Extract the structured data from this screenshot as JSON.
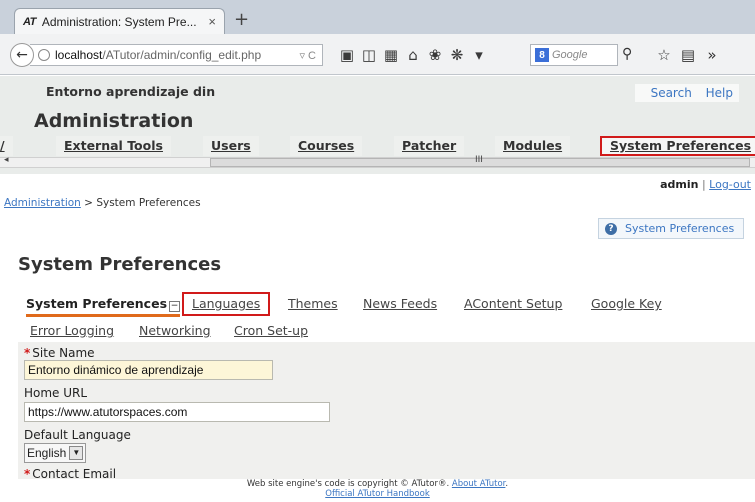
{
  "browser": {
    "tab_icon": "AT",
    "tab_title": "Administration: System Pre...",
    "tab_close": "×",
    "new_tab": "+",
    "url_host": "localhost",
    "url_path": "/ATutor/admin/config_edit.php",
    "search_engine_badge": "8",
    "search_placeholder": "Google",
    "overflow": "»",
    "icons": [
      "back-arrow-icon",
      "globe-icon",
      "reload-icon",
      "reader-icon",
      "sidebar-icon",
      "apps-icon",
      "home-icon",
      "extension-icon",
      "puzzle-icon",
      "dropdown-icon",
      "search-icon",
      "star-icon",
      "bookmarks-icon"
    ]
  },
  "header": {
    "site_name": "Entorno aprendizaje din",
    "search_link": "Search",
    "help_link": "Help",
    "admin_title": "Administration"
  },
  "main_tabs": [
    {
      "label": "/"
    },
    {
      "label": "External Tools"
    },
    {
      "label": "Users"
    },
    {
      "label": "Courses"
    },
    {
      "label": "Patcher"
    },
    {
      "label": "Modules"
    },
    {
      "label": "System Preferences"
    }
  ],
  "scrollbar": {
    "grip": "III",
    "left_arrow": "◂"
  },
  "user": {
    "name": "admin",
    "separator": "|",
    "logout": "Log-out"
  },
  "breadcrumb": {
    "parent": "Administration",
    "sep": " > ",
    "current": "System Preferences"
  },
  "help_box": {
    "label": "System Preferences"
  },
  "page_title": "System Preferences",
  "sub_tabs": [
    {
      "label": "System Preferences"
    },
    {
      "label": "Languages"
    },
    {
      "label": "Themes"
    },
    {
      "label": "News Feeds"
    },
    {
      "label": "AContent Setup"
    },
    {
      "label": "Google Key"
    }
  ],
  "sub_tabs_row2": [
    {
      "label": "Error Logging"
    },
    {
      "label": "Networking"
    },
    {
      "label": "Cron Set-up"
    }
  ],
  "form": {
    "required_mark": "*",
    "site_name_label": "Site Name",
    "site_name_value": "Entorno dinámico de aprendizaje",
    "home_url_label": "Home URL",
    "home_url_value": "https://www.atutorspaces.com",
    "default_language_label": "Default Language",
    "default_language_value": "English",
    "contact_email_label": "Contact Email"
  },
  "footer": {
    "copyright": "Web site engine's code is copyright © ATutor®.",
    "about_link": "About ATutor",
    "period": ".",
    "handbook_link": "Official ATutor Handbook"
  },
  "colors": {
    "highlight_box": "#d11a1a",
    "link": "#3c76c2",
    "active_underline": "#e06a1b",
    "required": "#d11a1a"
  }
}
